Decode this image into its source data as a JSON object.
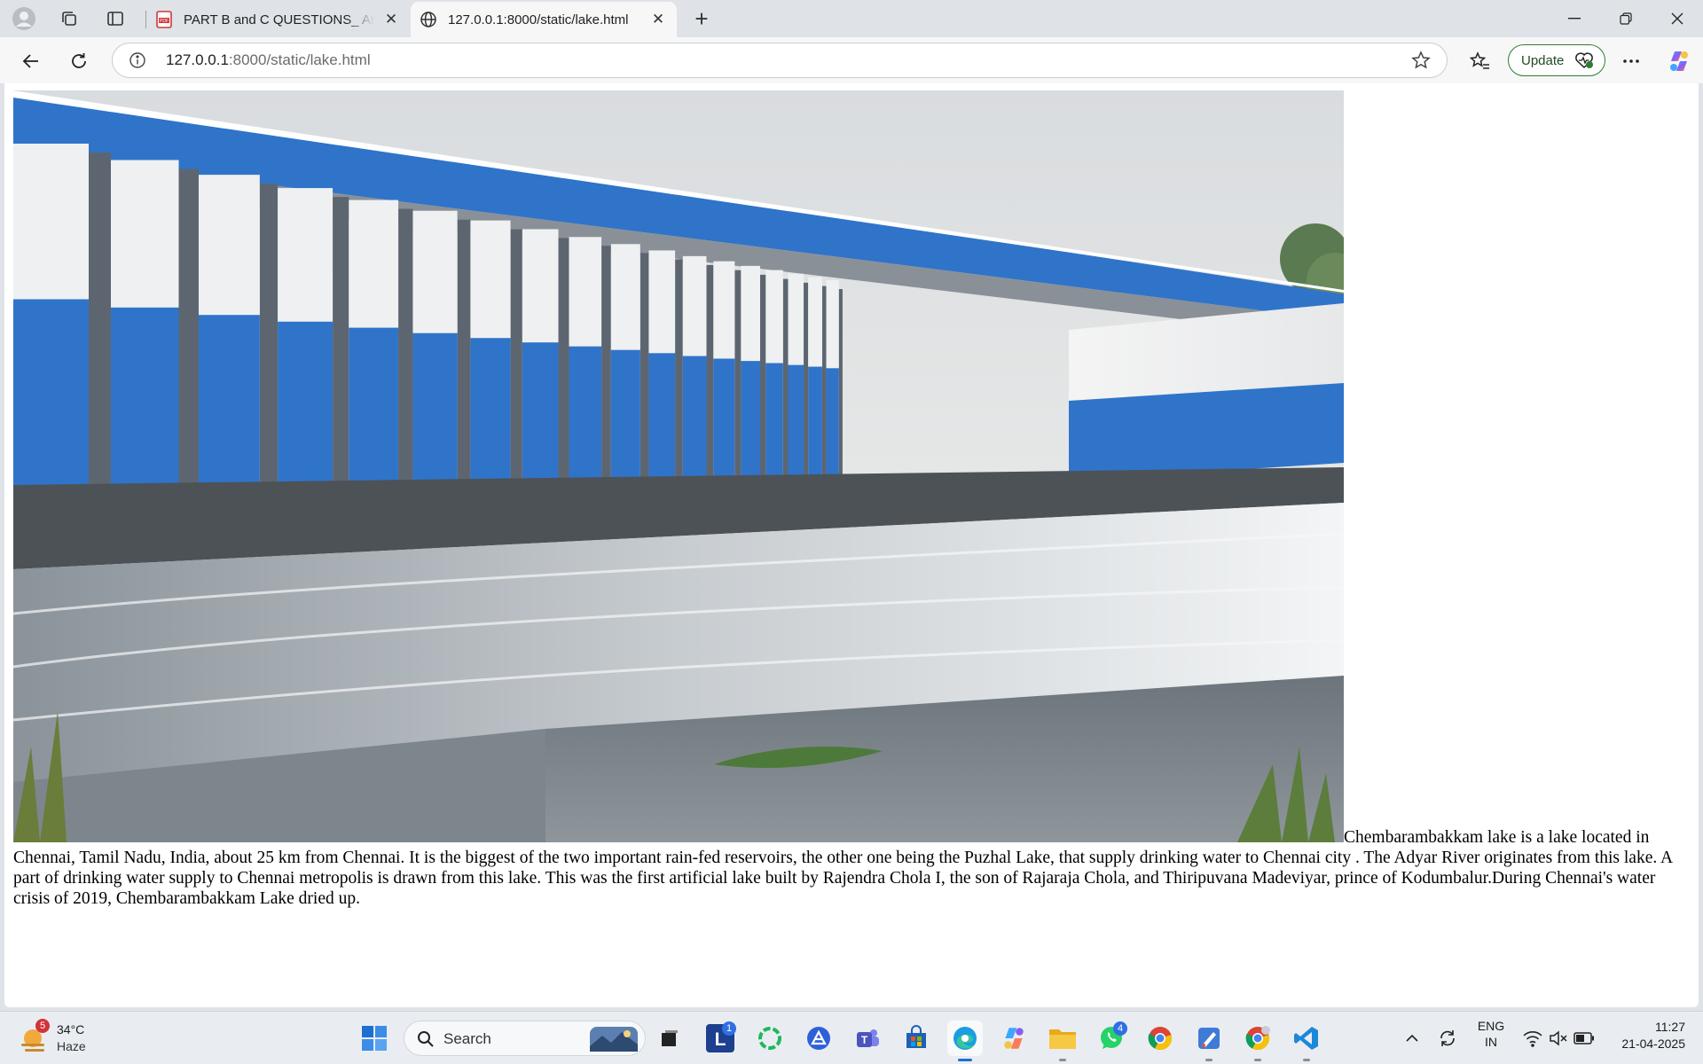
{
  "browser": {
    "tabs": [
      {
        "title": "PART B and C QUESTIONS_ Attem",
        "icon": "pdf-icon",
        "active": false
      },
      {
        "title": "127.0.0.1:8000/static/lake.html",
        "icon": "globe-icon",
        "active": true
      }
    ],
    "url_host": "127.0.0.1",
    "url_rest": ":8000/static/lake.html",
    "update_label": "Update"
  },
  "page": {
    "image_name": "lake-photo",
    "paragraph": "Chembarambakkam lake is a lake located in Chennai, Tamil Nadu, India, about 25 km from Chennai. It is the biggest of the two important rain-fed reservoirs, the other one being the Puzhal Lake, that supply drinking water to Chennai city . The Adyar River originates from this lake. A part of drinking water supply to Chennai metropolis is drawn from this lake. This was the first artificial lake built by Rajendra Chola I, the son of Rajaraja Chola, and Thiripuvana Madeviyar, prince of Kodumbalur.During Chennai's water crisis of 2019, Chembarambakkam Lake dried up."
  },
  "taskbar": {
    "weather": {
      "temp": "34°C",
      "condition": "Haze",
      "badge": "5"
    },
    "search_label": "Search",
    "apps": [
      {
        "name": "start",
        "icon": "windows-icon"
      },
      {
        "name": "task-view",
        "icon": "task-view-icon"
      },
      {
        "name": "lockdown-browser",
        "icon": "l-app-icon",
        "badge": "1"
      },
      {
        "name": "ring-app",
        "icon": "ring-icon"
      },
      {
        "name": "vector-app",
        "icon": "vector-icon"
      },
      {
        "name": "teams",
        "icon": "teams-icon"
      },
      {
        "name": "store",
        "icon": "store-icon"
      },
      {
        "name": "edge",
        "icon": "edge-icon"
      },
      {
        "name": "copilot",
        "icon": "copilot-icon"
      },
      {
        "name": "file-explorer",
        "icon": "folder-icon"
      },
      {
        "name": "whatsapp",
        "icon": "whatsapp-icon",
        "badge": "4"
      },
      {
        "name": "chrome",
        "icon": "chrome-icon"
      },
      {
        "name": "paint",
        "icon": "paint-icon"
      },
      {
        "name": "chrome-profile",
        "icon": "chrome-icon"
      },
      {
        "name": "vscode",
        "icon": "vscode-icon"
      }
    ],
    "tray": {
      "lang_top": "ENG",
      "lang_bottom": "IN",
      "time": "11:27",
      "date": "21-04-2025"
    }
  },
  "colors": {
    "accent": "#1f6fd1",
    "dam_blue": "#2f74c9",
    "update_border": "#2e7d32"
  }
}
